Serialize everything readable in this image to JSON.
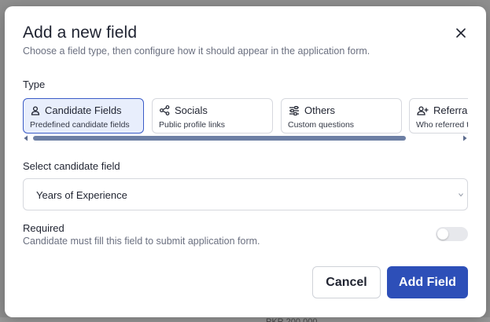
{
  "modal": {
    "title": "Add a new field",
    "subtitle": "Choose a field type, then configure how it should appear in the application form.",
    "close_icon": "close-icon"
  },
  "type_section": {
    "label": "Type",
    "cards": [
      {
        "title": "Candidate Fields",
        "subtitle": "Predefined candidate fields",
        "icon": "person-icon",
        "selected": true
      },
      {
        "title": "Socials",
        "subtitle": "Public profile links",
        "icon": "share-icon",
        "selected": false
      },
      {
        "title": "Others",
        "subtitle": "Custom questions",
        "icon": "sliders-icon",
        "selected": false
      },
      {
        "title": "Referral",
        "subtitle": "Who referred the candidate",
        "icon": "add-person-icon",
        "selected": false
      }
    ]
  },
  "candidate_field": {
    "label": "Select candidate field",
    "value": "Years of Experience"
  },
  "required": {
    "title": "Required",
    "description": "Candidate must fill this field to submit application form.",
    "enabled": false
  },
  "actions": {
    "cancel_label": "Cancel",
    "add_label": "Add Field"
  },
  "background": {
    "fragment": "PKR 200,000"
  },
  "colors": {
    "accent": "#2d4fb8",
    "selected_card_bg": "#e8eefc",
    "overlay": "#8f8f8f"
  }
}
